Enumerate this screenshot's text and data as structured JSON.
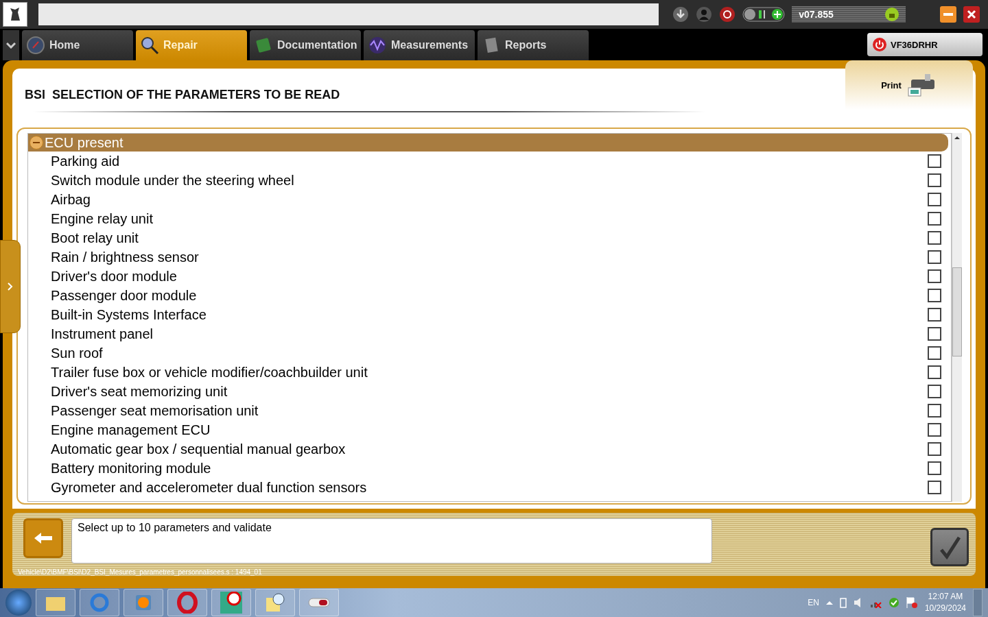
{
  "toolbar": {
    "version": "v07.855"
  },
  "tabs": [
    {
      "label": "Home",
      "selected": false
    },
    {
      "label": "Repair",
      "selected": true
    },
    {
      "label": "Documentation",
      "selected": false
    },
    {
      "label": "Measurements",
      "selected": false
    },
    {
      "label": "Reports",
      "selected": false
    }
  ],
  "vehicle": {
    "vin": "VF36DRHR"
  },
  "page": {
    "title": "BSI  SELECTION OF THE PARAMETERS TO BE READ",
    "print_label": "Print"
  },
  "group": {
    "label": "ECU present",
    "expanded": true,
    "items": [
      {
        "label": "Parking aid",
        "checked": false
      },
      {
        "label": "Switch module under the steering wheel",
        "checked": false
      },
      {
        "label": "Airbag",
        "checked": false
      },
      {
        "label": "Engine relay unit",
        "checked": false
      },
      {
        "label": "Boot relay unit",
        "checked": false
      },
      {
        "label": "Rain / brightness sensor",
        "checked": false
      },
      {
        "label": "Driver's door module",
        "checked": false
      },
      {
        "label": "Passenger door module",
        "checked": false
      },
      {
        "label": "Built-in Systems Interface",
        "checked": false
      },
      {
        "label": "Instrument panel",
        "checked": false
      },
      {
        "label": "Sun roof",
        "checked": false
      },
      {
        "label": "Trailer fuse box or vehicle modifier/coachbuilder unit",
        "checked": false
      },
      {
        "label": "Driver's seat memorizing unit",
        "checked": false
      },
      {
        "label": "Passenger seat memorisation unit",
        "checked": false
      },
      {
        "label": "Engine management ECU",
        "checked": false
      },
      {
        "label": "Automatic gear box / sequential manual gearbox",
        "checked": false
      },
      {
        "label": "Battery monitoring module",
        "checked": false
      },
      {
        "label": "Gyrometer and accelerometer dual function sensors",
        "checked": false
      }
    ]
  },
  "footer": {
    "message": "Select up to 10 parameters and validate",
    "path": "Vehicle\\D2\\BMF\\BSI\\D2_BSI_Mesures_parametres_personnalisees.s : 1494_01"
  },
  "taskbar": {
    "language": "EN",
    "time": "12:07 AM",
    "date": "10/29/2024"
  }
}
